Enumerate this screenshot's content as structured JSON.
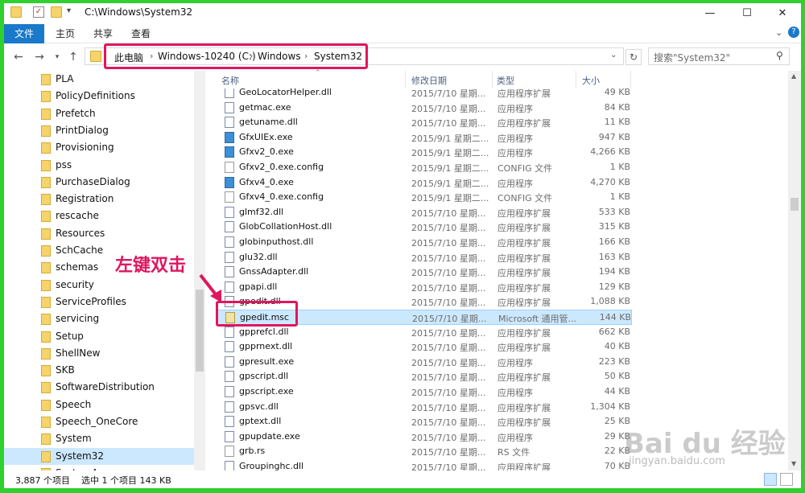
{
  "title_bar": {
    "path_title": "C:\\Windows\\System32",
    "minimize": "—",
    "maximize": "☐",
    "close": "✕"
  },
  "ribbon": {
    "file_tab": "文件",
    "tabs": [
      "主页",
      "共享",
      "查看"
    ]
  },
  "address": {
    "crumbs": [
      "此电脑",
      "Windows-10240 (C:)",
      "Windows",
      "System32"
    ],
    "separator": "›"
  },
  "search": {
    "placeholder": "搜索\"System32\""
  },
  "columns": {
    "name": "名称",
    "date": "修改日期",
    "type": "类型",
    "size": "大小"
  },
  "sidebar": {
    "items": [
      {
        "label": "PLA"
      },
      {
        "label": "PolicyDefinitions"
      },
      {
        "label": "Prefetch"
      },
      {
        "label": "PrintDialog"
      },
      {
        "label": "Provisioning"
      },
      {
        "label": "pss"
      },
      {
        "label": "PurchaseDialog"
      },
      {
        "label": "Registration"
      },
      {
        "label": "rescache"
      },
      {
        "label": "Resources"
      },
      {
        "label": "SchCache"
      },
      {
        "label": "schemas"
      },
      {
        "label": "security"
      },
      {
        "label": "ServiceProfiles"
      },
      {
        "label": "servicing"
      },
      {
        "label": "Setup"
      },
      {
        "label": "ShellNew"
      },
      {
        "label": "SKB"
      },
      {
        "label": "SoftwareDistribution"
      },
      {
        "label": "Speech"
      },
      {
        "label": "Speech_OneCore"
      },
      {
        "label": "System"
      },
      {
        "label": "System32"
      },
      {
        "label": "SystemApps"
      }
    ],
    "selected": "System32"
  },
  "files": [
    {
      "name": "GeoLocatorHelper.dll",
      "date": "2015/7/10 星期...",
      "type": "应用程序扩展",
      "size": "49 KB",
      "icon": "dll"
    },
    {
      "name": "getmac.exe",
      "date": "2015/7/10 星期...",
      "type": "应用程序",
      "size": "84 KB",
      "icon": "dll"
    },
    {
      "name": "getuname.dll",
      "date": "2015/7/10 星期...",
      "type": "应用程序扩展",
      "size": "11 KB",
      "icon": "dll"
    },
    {
      "name": "GfxUIEx.exe",
      "date": "2015/9/1 星期二...",
      "type": "应用程序",
      "size": "947 KB",
      "icon": "exe"
    },
    {
      "name": "Gfxv2_0.exe",
      "date": "2015/9/1 星期二...",
      "type": "应用程序",
      "size": "4,266 KB",
      "icon": "exe"
    },
    {
      "name": "Gfxv2_0.exe.config",
      "date": "2015/9/1 星期二...",
      "type": "CONFIG 文件",
      "size": "1 KB",
      "icon": "cfg"
    },
    {
      "name": "Gfxv4_0.exe",
      "date": "2015/9/1 星期二...",
      "type": "应用程序",
      "size": "4,270 KB",
      "icon": "exe"
    },
    {
      "name": "Gfxv4_0.exe.config",
      "date": "2015/9/1 星期二...",
      "type": "CONFIG 文件",
      "size": "1 KB",
      "icon": "cfg"
    },
    {
      "name": "glmf32.dll",
      "date": "2015/7/10 星期...",
      "type": "应用程序扩展",
      "size": "533 KB",
      "icon": "dll"
    },
    {
      "name": "GlobCollationHost.dll",
      "date": "2015/7/10 星期...",
      "type": "应用程序扩展",
      "size": "315 KB",
      "icon": "dll"
    },
    {
      "name": "globinputhost.dll",
      "date": "2015/7/10 星期...",
      "type": "应用程序扩展",
      "size": "166 KB",
      "icon": "dll"
    },
    {
      "name": "glu32.dll",
      "date": "2015/7/10 星期...",
      "type": "应用程序扩展",
      "size": "163 KB",
      "icon": "dll"
    },
    {
      "name": "GnssAdapter.dll",
      "date": "2015/7/10 星期...",
      "type": "应用程序扩展",
      "size": "194 KB",
      "icon": "dll"
    },
    {
      "name": "gpapi.dll",
      "date": "2015/7/10 星期...",
      "type": "应用程序扩展",
      "size": "129 KB",
      "icon": "dll"
    },
    {
      "name": "gpedit.dll",
      "date": "2015/7/10 星期...",
      "type": "应用程序扩展",
      "size": "1,088 KB",
      "icon": "dll"
    },
    {
      "name": "gpedit.msc",
      "date": "2015/7/10 星期...",
      "type": "Microsoft 通用管...",
      "size": "144 KB",
      "icon": "msc"
    },
    {
      "name": "gpprefcl.dll",
      "date": "2015/7/10 星期...",
      "type": "应用程序扩展",
      "size": "662 KB",
      "icon": "dll"
    },
    {
      "name": "gpprnext.dll",
      "date": "2015/7/10 星期...",
      "type": "应用程序扩展",
      "size": "40 KB",
      "icon": "dll"
    },
    {
      "name": "gpresult.exe",
      "date": "2015/7/10 星期...",
      "type": "应用程序",
      "size": "223 KB",
      "icon": "dll"
    },
    {
      "name": "gpscript.dll",
      "date": "2015/7/10 星期...",
      "type": "应用程序扩展",
      "size": "50 KB",
      "icon": "dll"
    },
    {
      "name": "gpscript.exe",
      "date": "2015/7/10 星期...",
      "type": "应用程序",
      "size": "44 KB",
      "icon": "dll"
    },
    {
      "name": "gpsvc.dll",
      "date": "2015/7/10 星期...",
      "type": "应用程序扩展",
      "size": "1,304 KB",
      "icon": "dll"
    },
    {
      "name": "gptext.dll",
      "date": "2015/7/10 星期...",
      "type": "应用程序扩展",
      "size": "25 KB",
      "icon": "dll"
    },
    {
      "name": "gpupdate.exe",
      "date": "2015/7/10 星期...",
      "type": "应用程序",
      "size": "29 KB",
      "icon": "dll"
    },
    {
      "name": "grb.rs",
      "date": "2015/7/10 星期...",
      "type": "RS 文件",
      "size": "22 KB",
      "icon": "cfg"
    },
    {
      "name": "Groupinghc.dll",
      "date": "2015/7/10 星期...",
      "type": "应用程序扩展",
      "size": "70 KB",
      "icon": "dll"
    }
  ],
  "selected_file": "gpedit.msc",
  "status": {
    "count": "3,887 个项目",
    "selection": "选中 1 个项目  143 KB"
  },
  "annotation": {
    "callout": "左键双击",
    "highlight_color": "#e0165e"
  },
  "watermark": {
    "main": "Bai du 经验",
    "sub": "jingyan.baidu.com"
  }
}
